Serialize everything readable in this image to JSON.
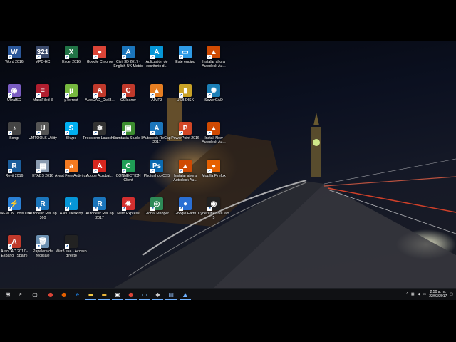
{
  "desktop": {
    "icons": [
      {
        "name": "word-2016-icon",
        "label": "Word 2016",
        "glyph": "W",
        "color": "#2b579a"
      },
      {
        "name": "mpc-hc-icon",
        "label": "MPC-HC",
        "glyph": "321",
        "color": "#3b4a6b"
      },
      {
        "name": "excel-2016-icon",
        "label": "Excel 2016",
        "glyph": "X",
        "color": "#217346"
      },
      {
        "name": "google-chrome-icon",
        "label": "Google Chrome",
        "glyph": "●",
        "color": "#db4437"
      },
      {
        "name": "civil-3d-icon",
        "label": "Civil 3D 2017 - English UK Metric",
        "glyph": "A",
        "color": "#1b75bb"
      },
      {
        "name": "autodesk-desktop-app-icon",
        "label": "Aplicación de escritorio d...",
        "glyph": "A",
        "color": "#0696d7"
      },
      {
        "name": "this-pc-icon",
        "label": "Este equipo",
        "glyph": "▭",
        "color": "#2f9be6"
      },
      {
        "name": "install-autodesk-icon",
        "label": "Instalar ahora Autodesk Au...",
        "glyph": "▲",
        "color": "#d04a02"
      },
      {
        "name": "ultraiso-icon",
        "label": "UltraISO",
        "glyph": "◉",
        "color": "#7a5cc2"
      },
      {
        "name": "missfiled-icon",
        "label": "MassFiled 3",
        "glyph": "≡",
        "color": "#b01e2f"
      },
      {
        "name": "utorrent-icon",
        "label": "µTorrent",
        "glyph": "µ",
        "color": "#76b83f"
      },
      {
        "name": "autocad-civil-icon",
        "label": "AutoCAD_Civil3...",
        "glyph": "A",
        "color": "#c0392b"
      },
      {
        "name": "ccleaner-icon",
        "label": "CCleaner",
        "glyph": "C",
        "color": "#c0392b"
      },
      {
        "name": "aimp-icon",
        "label": "AIMP3",
        "glyph": "▲",
        "color": "#e67e22"
      },
      {
        "name": "usb-disk-icon",
        "label": "USB DISK",
        "glyph": "▮",
        "color": "#c9a227"
      },
      {
        "name": "sewercad-icon",
        "label": "SewerCAD",
        "glyph": "✺",
        "color": "#1b7fb7"
      },
      {
        "name": "songr-icon",
        "label": "Songr",
        "glyph": "♪",
        "color": "#444"
      },
      {
        "name": "umtools-icon",
        "label": "UMTOOLS Utility",
        "glyph": "U",
        "color": "#555"
      },
      {
        "name": "skype-icon",
        "label": "Skype",
        "glyph": "S",
        "color": "#00aff0"
      },
      {
        "name": "freestorm-icon",
        "label": "Freestorm Launcher",
        "glyph": "❄",
        "color": "#333"
      },
      {
        "name": "camtasia-icon",
        "label": "Camtasia Studio 8",
        "glyph": "▣",
        "color": "#3c8d2f"
      },
      {
        "name": "autodesk-recap-icon",
        "label": "Autodesk ReCap 2017",
        "glyph": "A",
        "color": "#1b75bb"
      },
      {
        "name": "powerpoint-icon",
        "label": "PowerPoint 2016",
        "glyph": "P",
        "color": "#d24726"
      },
      {
        "name": "install-now-autodesk-icon",
        "label": "Install Now Autodesk Au...",
        "glyph": "▲",
        "color": "#d04a02"
      },
      {
        "name": "revit-icon",
        "label": "Revit 2016",
        "glyph": "R",
        "color": "#1b5e9c"
      },
      {
        "name": "etabs-icon",
        "label": "ETABS 2016",
        "glyph": "▦",
        "color": "#8a9bb0"
      },
      {
        "name": "avast-icon",
        "label": "Avast Free Antivirus",
        "glyph": "a",
        "color": "#f47a20"
      },
      {
        "name": "acrobat-icon",
        "label": "Adobe Acrobat...",
        "glyph": "A",
        "color": "#d7261e"
      },
      {
        "name": "connection-client-icon",
        "label": "CONNECTION Client",
        "glyph": "C",
        "color": "#1f9d55"
      },
      {
        "name": "photoshop-icon",
        "label": "Photoshop CS5",
        "glyph": "Ps",
        "color": "#0b6ab0"
      },
      {
        "name": "install-autodesk-2-icon",
        "label": "Instalar ahora Autodesk Au...",
        "glyph": "▲",
        "color": "#d04a02"
      },
      {
        "name": "firefox-icon",
        "label": "Mozilla Firefox",
        "glyph": "●",
        "color": "#e66000"
      },
      {
        "name": "daemon-tools-icon",
        "label": "DAEMON Tools Lite",
        "glyph": "⚡",
        "color": "#2a7fd4"
      },
      {
        "name": "autodesk-recap-360-icon",
        "label": "Autodesk ReCap 360",
        "glyph": "R",
        "color": "#1b75bb"
      },
      {
        "name": "a360-icon",
        "label": "A360 Desktop",
        "glyph": "◐",
        "color": "#0696d7"
      },
      {
        "name": "autodesk-recap-2-icon",
        "label": "Autodesk ReCap 2017",
        "glyph": "R",
        "color": "#1b75bb"
      },
      {
        "name": "nero-express-icon",
        "label": "Nero Express",
        "glyph": "✹",
        "color": "#d32f2f"
      },
      {
        "name": "global-mapper-icon",
        "label": "Global Mapper",
        "glyph": "◎",
        "color": "#2e8b57"
      },
      {
        "name": "google-earth-icon",
        "label": "Google Earth",
        "glyph": "●",
        "color": "#2a6fd4"
      },
      {
        "name": "cyberlink-youcam-icon",
        "label": "CyberLink YouCam 5",
        "glyph": "◉",
        "color": "#222"
      },
      {
        "name": "autocad-2017-icon",
        "label": "AutoCAD 2017 - Español (Spain)",
        "glyph": "A",
        "color": "#c0392b"
      },
      {
        "name": "recycle-bin-icon",
        "label": "Papelera de reciclaje",
        "glyph": "🗑",
        "color": "#6a8fb0"
      },
      {
        "name": "war3-shortcut-icon",
        "label": "War3.exe - Acceso directo",
        "glyph": "",
        "color": "#222"
      }
    ]
  },
  "taskbar": {
    "start": "⊞",
    "search": "⌕",
    "task_view": "▢",
    "apps": [
      {
        "name": "taskbar-chrome-icon",
        "glyph": "●",
        "color": "#db4437"
      },
      {
        "name": "taskbar-firefox-icon",
        "glyph": "●",
        "color": "#e66000"
      },
      {
        "name": "taskbar-edge-icon",
        "glyph": "e",
        "color": "#1e90ff"
      },
      {
        "name": "taskbar-explorer-icon",
        "glyph": "▬",
        "color": "#f2c744"
      },
      {
        "name": "taskbar-folder-icon",
        "glyph": "▬",
        "color": "#e8b339"
      },
      {
        "name": "taskbar-store-icon",
        "glyph": "▣",
        "color": "#ffffff"
      },
      {
        "name": "taskbar-chrome-2-icon",
        "glyph": "●",
        "color": "#db4437"
      },
      {
        "name": "taskbar-window-icon",
        "glyph": "▭",
        "color": "#7ac3ff"
      },
      {
        "name": "taskbar-app-icon",
        "glyph": "◆",
        "color": "#c9c9c9"
      },
      {
        "name": "taskbar-revit-icon",
        "glyph": "▤",
        "color": "#8ab4e8"
      },
      {
        "name": "taskbar-autodesk-icon",
        "glyph": "▲",
        "color": "#6fb1ff"
      }
    ],
    "tray": {
      "chevron": "^",
      "clock_time": "2:50 a. m.",
      "clock_date": "22/03/2017"
    }
  }
}
